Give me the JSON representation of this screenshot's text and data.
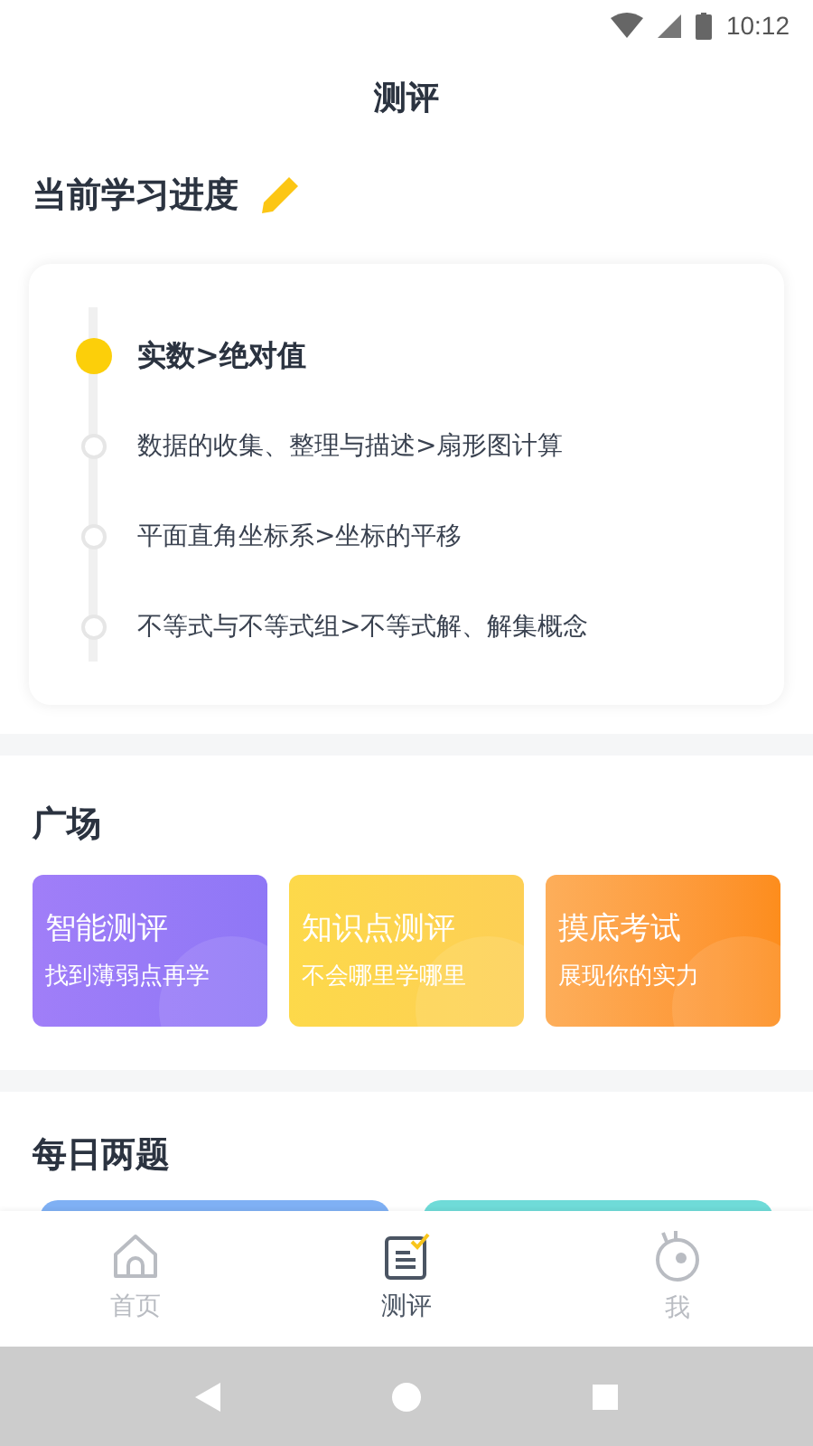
{
  "status_bar": {
    "time": "10:12"
  },
  "header": {
    "title": "测评"
  },
  "progress": {
    "title": "当前学习进度",
    "items": [
      {
        "label": "实数>绝对值",
        "selected": true
      },
      {
        "label": "数据的收集、整理与描述>扇形图计算",
        "selected": false
      },
      {
        "label": "平面直角坐标系>坐标的平移",
        "selected": false
      },
      {
        "label": "不等式与不等式组>不等式解、解集概念",
        "selected": false
      }
    ]
  },
  "plaza": {
    "title": "广场",
    "cards": [
      {
        "title": "智能测评",
        "subtitle": "找到薄弱点再学",
        "color": "#9b7cf7"
      },
      {
        "title": "知识点测评",
        "subtitle": "不会哪里学哪里",
        "color": "#fdd54a"
      },
      {
        "title": "摸底考试",
        "subtitle": "展现你的实力",
        "color": "#fd9a36"
      }
    ]
  },
  "daily": {
    "title": "每日两题"
  },
  "tabs": [
    {
      "kind": "home",
      "label": "首页",
      "selected": false
    },
    {
      "kind": "test",
      "label": "测评",
      "selected": true
    },
    {
      "kind": "me",
      "label": "我",
      "selected": false
    }
  ]
}
